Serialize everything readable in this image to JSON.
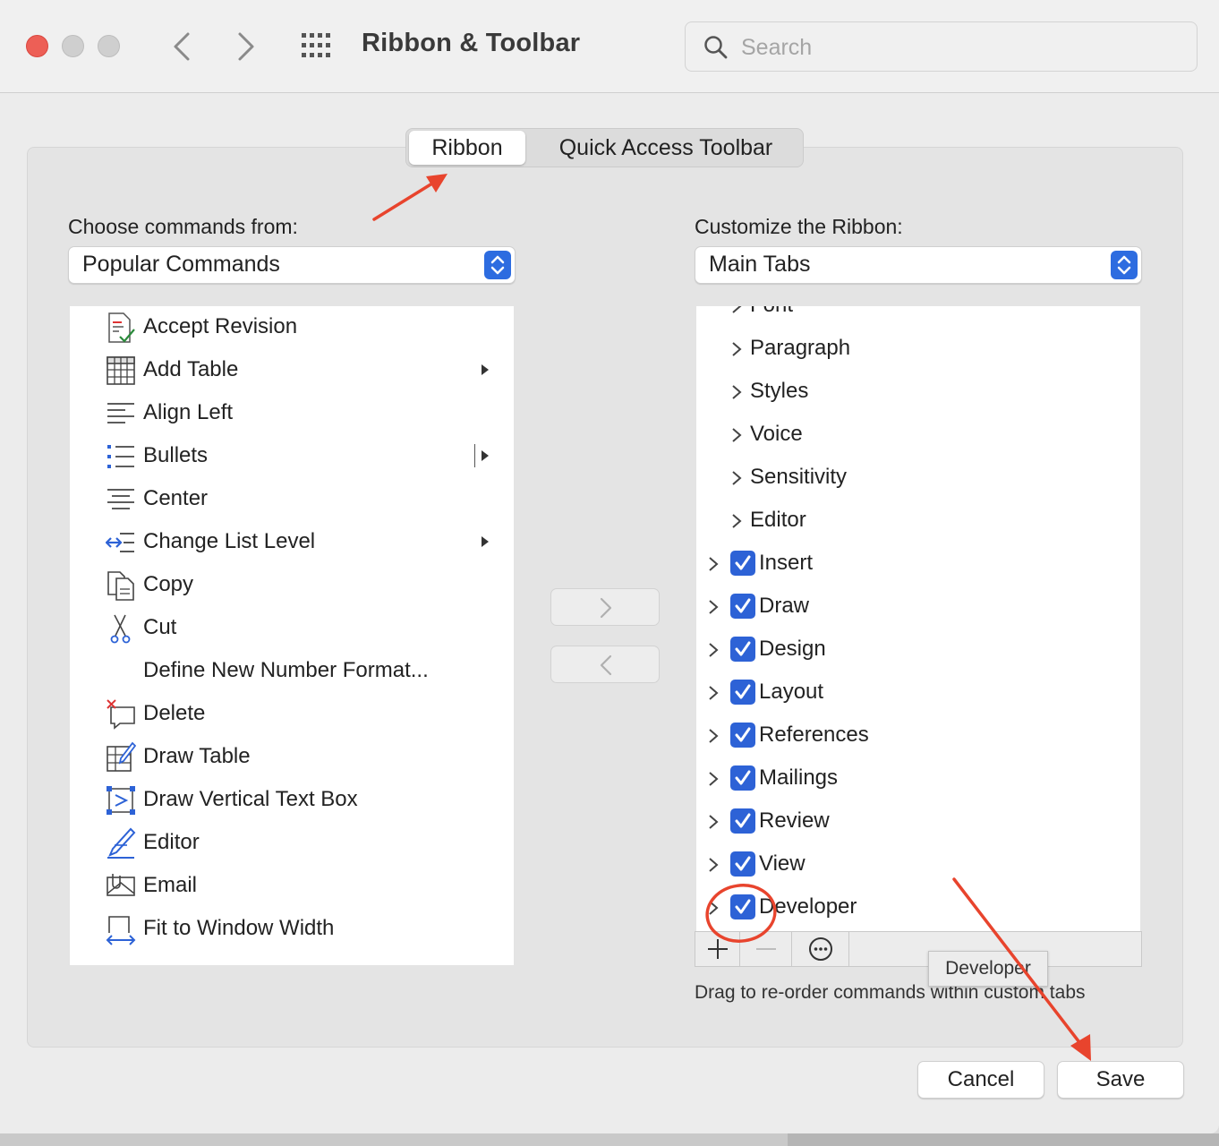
{
  "window": {
    "title": "Ribbon & Toolbar",
    "search_placeholder": "Search"
  },
  "tabs": {
    "ribbon": "Ribbon",
    "quick_access": "Quick Access Toolbar",
    "selected": "Ribbon"
  },
  "left": {
    "label": "Choose commands from:",
    "dropdown_value": "Popular Commands",
    "commands": [
      {
        "label": "Accept Revision",
        "icon": "accept-revision-icon"
      },
      {
        "label": "Add Table",
        "icon": "table-icon",
        "submenu": true
      },
      {
        "label": "Align Left",
        "icon": "align-left-icon"
      },
      {
        "label": "Bullets",
        "icon": "bullets-icon",
        "submenu": true,
        "split": true
      },
      {
        "label": "Center",
        "icon": "align-center-icon"
      },
      {
        "label": "Change List Level",
        "icon": "list-level-icon",
        "submenu": true
      },
      {
        "label": "Copy",
        "icon": "copy-icon"
      },
      {
        "label": "Cut",
        "icon": "scissors-icon"
      },
      {
        "label": "Define New Number Format...",
        "icon": ""
      },
      {
        "label": "Delete",
        "icon": "delete-comment-icon"
      },
      {
        "label": "Draw Table",
        "icon": "draw-table-icon"
      },
      {
        "label": "Draw Vertical Text Box",
        "icon": "vertical-text-box-icon"
      },
      {
        "label": "Editor",
        "icon": "editor-pen-icon"
      },
      {
        "label": "Email",
        "icon": "email-icon"
      },
      {
        "label": "Fit to Window Width",
        "icon": "fit-width-icon"
      }
    ]
  },
  "right": {
    "label": "Customize the Ribbon:",
    "dropdown_value": "Main Tabs",
    "tree": [
      {
        "label": "Font",
        "level": 1
      },
      {
        "label": "Paragraph",
        "level": 1
      },
      {
        "label": "Styles",
        "level": 1
      },
      {
        "label": "Voice",
        "level": 1
      },
      {
        "label": "Sensitivity",
        "level": 1
      },
      {
        "label": "Editor",
        "level": 1
      },
      {
        "label": "Insert",
        "level": 0,
        "checked": true
      },
      {
        "label": "Draw",
        "level": 0,
        "checked": true
      },
      {
        "label": "Design",
        "level": 0,
        "checked": true
      },
      {
        "label": "Layout",
        "level": 0,
        "checked": true
      },
      {
        "label": "References",
        "level": 0,
        "checked": true
      },
      {
        "label": "Mailings",
        "level": 0,
        "checked": true
      },
      {
        "label": "Review",
        "level": 0,
        "checked": true
      },
      {
        "label": "View",
        "level": 0,
        "checked": true
      },
      {
        "label": "Developer",
        "level": 0,
        "checked": true
      }
    ],
    "tooltip": "Developer",
    "hint": "Drag to re-order commands within custom tabs"
  },
  "buttons": {
    "cancel": "Cancel",
    "save": "Save"
  },
  "colors": {
    "accent": "#2d62d6",
    "annotation": "#e8442d",
    "close_light": "#ed5f56"
  }
}
